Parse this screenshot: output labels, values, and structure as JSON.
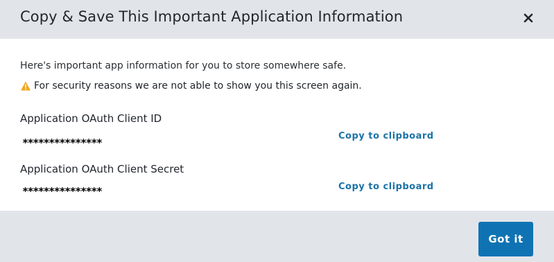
{
  "dialog": {
    "title": "Copy & Save This Important Application Information",
    "close_icon": "close-icon"
  },
  "body": {
    "intro": "Here's important app information for you to store somewhere safe.",
    "warning": {
      "icon": "warning-icon",
      "icon_color": "#f0a520",
      "text": "For security reasons we are not able to show you this screen again."
    },
    "fields": [
      {
        "label": "Application OAuth Client ID",
        "value": "***************",
        "copy_label": "Copy to clipboard"
      },
      {
        "label": "Application OAuth Client Secret",
        "value": "***************",
        "copy_label": "Copy to clipboard"
      }
    ]
  },
  "footer": {
    "confirm_label": "Got it"
  },
  "colors": {
    "header_bg": "#e1e5e9",
    "link": "#1a73a8",
    "primary_button": "#0f73b3"
  }
}
